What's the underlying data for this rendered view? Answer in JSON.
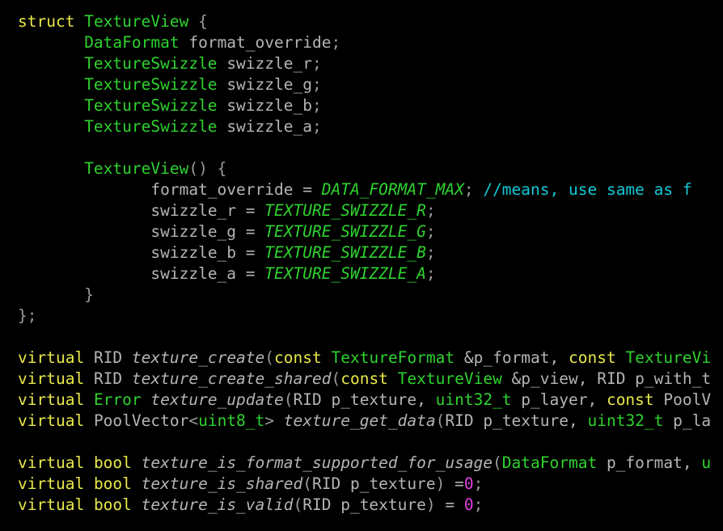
{
  "editor": {
    "language": "cpp",
    "background_color": "#000000",
    "default_text_color": "#b4b4b4",
    "font_size_px": 19.5,
    "line_height_px": 26,
    "tab_width_chars": 7,
    "lines_visible": 25,
    "horizontal_clipping": true
  },
  "theme": {
    "keyword": "#e8e84a",
    "type": "#2fd22f",
    "identifier": "#b4b4b4",
    "function_name": "#b4b4b4",
    "constant": "#2fd22f",
    "comment": "#14c8d7",
    "number": "#e040e0",
    "punctuation": "#9a9a9a"
  },
  "code": {
    "lines": [
      {
        "id": "line-1",
        "indent": 0,
        "tokens": [
          {
            "t": "struct",
            "k": "keyword"
          },
          {
            "t": " ",
            "k": "plain"
          },
          {
            "t": "TextureView",
            "k": "type"
          },
          {
            "t": " ",
            "k": "plain"
          },
          {
            "t": "{",
            "k": "punct"
          }
        ]
      },
      {
        "id": "line-2",
        "indent": 1,
        "tokens": [
          {
            "t": "DataFormat",
            "k": "type"
          },
          {
            "t": " ",
            "k": "plain"
          },
          {
            "t": "format_override",
            "k": "member"
          },
          {
            "t": ";",
            "k": "punct"
          }
        ]
      },
      {
        "id": "line-3",
        "indent": 1,
        "tokens": [
          {
            "t": "TextureSwizzle",
            "k": "type"
          },
          {
            "t": " ",
            "k": "plain"
          },
          {
            "t": "swizzle_r",
            "k": "member"
          },
          {
            "t": ";",
            "k": "punct"
          }
        ]
      },
      {
        "id": "line-4",
        "indent": 1,
        "tokens": [
          {
            "t": "TextureSwizzle",
            "k": "type"
          },
          {
            "t": " ",
            "k": "plain"
          },
          {
            "t": "swizzle_g",
            "k": "member"
          },
          {
            "t": ";",
            "k": "punct"
          }
        ]
      },
      {
        "id": "line-5",
        "indent": 1,
        "tokens": [
          {
            "t": "TextureSwizzle",
            "k": "type"
          },
          {
            "t": " ",
            "k": "plain"
          },
          {
            "t": "swizzle_b",
            "k": "member"
          },
          {
            "t": ";",
            "k": "punct"
          }
        ]
      },
      {
        "id": "line-6",
        "indent": 1,
        "tokens": [
          {
            "t": "TextureSwizzle",
            "k": "type"
          },
          {
            "t": " ",
            "k": "plain"
          },
          {
            "t": "swizzle_a",
            "k": "member"
          },
          {
            "t": ";",
            "k": "punct"
          }
        ]
      },
      {
        "id": "line-7",
        "indent": 0,
        "tokens": []
      },
      {
        "id": "line-8",
        "indent": 1,
        "tokens": [
          {
            "t": "TextureView",
            "k": "type"
          },
          {
            "t": "()",
            "k": "punct"
          },
          {
            "t": " ",
            "k": "plain"
          },
          {
            "t": "{",
            "k": "punct"
          }
        ]
      },
      {
        "id": "line-9",
        "indent": 2,
        "tokens": [
          {
            "t": "format_override",
            "k": "ident"
          },
          {
            "t": " = ",
            "k": "op"
          },
          {
            "t": "DATA_FORMAT_MAX",
            "k": "const"
          },
          {
            "t": ";",
            "k": "punct"
          },
          {
            "t": " ",
            "k": "plain"
          },
          {
            "t": "//means, use same as f",
            "k": "comment"
          }
        ]
      },
      {
        "id": "line-10",
        "indent": 2,
        "tokens": [
          {
            "t": "swizzle_r",
            "k": "ident"
          },
          {
            "t": " = ",
            "k": "op"
          },
          {
            "t": "TEXTURE_SWIZZLE_R",
            "k": "const"
          },
          {
            "t": ";",
            "k": "punct"
          }
        ]
      },
      {
        "id": "line-11",
        "indent": 2,
        "tokens": [
          {
            "t": "swizzle_g",
            "k": "ident"
          },
          {
            "t": " = ",
            "k": "op"
          },
          {
            "t": "TEXTURE_SWIZZLE_G",
            "k": "const"
          },
          {
            "t": ";",
            "k": "punct"
          }
        ]
      },
      {
        "id": "line-12",
        "indent": 2,
        "tokens": [
          {
            "t": "swizzle_b",
            "k": "ident"
          },
          {
            "t": " = ",
            "k": "op"
          },
          {
            "t": "TEXTURE_SWIZZLE_B",
            "k": "const"
          },
          {
            "t": ";",
            "k": "punct"
          }
        ]
      },
      {
        "id": "line-13",
        "indent": 2,
        "tokens": [
          {
            "t": "swizzle_a",
            "k": "ident"
          },
          {
            "t": " = ",
            "k": "op"
          },
          {
            "t": "TEXTURE_SWIZZLE_A",
            "k": "const"
          },
          {
            "t": ";",
            "k": "punct"
          }
        ]
      },
      {
        "id": "line-14",
        "indent": 1,
        "tokens": [
          {
            "t": "}",
            "k": "punct"
          }
        ]
      },
      {
        "id": "line-15",
        "indent": 0,
        "tokens": [
          {
            "t": "};",
            "k": "punct"
          }
        ]
      },
      {
        "id": "line-16",
        "indent": 0,
        "tokens": []
      },
      {
        "id": "line-17",
        "indent": 0,
        "tokens": [
          {
            "t": "virtual",
            "k": "keyword"
          },
          {
            "t": " ",
            "k": "plain"
          },
          {
            "t": "RID",
            "k": "ident"
          },
          {
            "t": " ",
            "k": "plain"
          },
          {
            "t": "texture_create",
            "k": "func"
          },
          {
            "t": "(",
            "k": "punct"
          },
          {
            "t": "const",
            "k": "keyword"
          },
          {
            "t": " ",
            "k": "plain"
          },
          {
            "t": "TextureFormat",
            "k": "type"
          },
          {
            "t": " &p_format, ",
            "k": "ident"
          },
          {
            "t": "const",
            "k": "keyword"
          },
          {
            "t": " ",
            "k": "plain"
          },
          {
            "t": "TextureVi",
            "k": "type"
          }
        ]
      },
      {
        "id": "line-18",
        "indent": 0,
        "tokens": [
          {
            "t": "virtual",
            "k": "keyword"
          },
          {
            "t": " ",
            "k": "plain"
          },
          {
            "t": "RID",
            "k": "ident"
          },
          {
            "t": " ",
            "k": "plain"
          },
          {
            "t": "texture_create_shared",
            "k": "func"
          },
          {
            "t": "(",
            "k": "punct"
          },
          {
            "t": "const",
            "k": "keyword"
          },
          {
            "t": " ",
            "k": "plain"
          },
          {
            "t": "TextureView",
            "k": "type"
          },
          {
            "t": " &p_view, RID p_with_t",
            "k": "ident"
          }
        ]
      },
      {
        "id": "line-19",
        "indent": 0,
        "tokens": [
          {
            "t": "virtual",
            "k": "keyword"
          },
          {
            "t": " ",
            "k": "plain"
          },
          {
            "t": "Error",
            "k": "type"
          },
          {
            "t": " ",
            "k": "plain"
          },
          {
            "t": "texture_update",
            "k": "func"
          },
          {
            "t": "(",
            "k": "punct"
          },
          {
            "t": "RID p_texture, ",
            "k": "ident"
          },
          {
            "t": "uint32_t",
            "k": "type"
          },
          {
            "t": " p_layer, ",
            "k": "ident"
          },
          {
            "t": "const",
            "k": "keyword"
          },
          {
            "t": " ",
            "k": "plain"
          },
          {
            "t": "PoolV",
            "k": "ident"
          }
        ]
      },
      {
        "id": "line-20",
        "indent": 0,
        "tokens": [
          {
            "t": "virtual",
            "k": "keyword"
          },
          {
            "t": " ",
            "k": "plain"
          },
          {
            "t": "PoolVector",
            "k": "ident"
          },
          {
            "t": "<",
            "k": "punct"
          },
          {
            "t": "uint8_t",
            "k": "type"
          },
          {
            "t": ">",
            "k": "punct"
          },
          {
            "t": " ",
            "k": "plain"
          },
          {
            "t": "texture_get_data",
            "k": "func"
          },
          {
            "t": "(",
            "k": "punct"
          },
          {
            "t": "RID p_texture, ",
            "k": "ident"
          },
          {
            "t": "uint32_t",
            "k": "type"
          },
          {
            "t": " p_la",
            "k": "ident"
          }
        ]
      },
      {
        "id": "line-21",
        "indent": 0,
        "tokens": []
      },
      {
        "id": "line-22",
        "indent": 0,
        "tokens": [
          {
            "t": "virtual",
            "k": "keyword"
          },
          {
            "t": " ",
            "k": "plain"
          },
          {
            "t": "bool",
            "k": "keyword"
          },
          {
            "t": " ",
            "k": "plain"
          },
          {
            "t": "texture_is_format_supported_for_usage",
            "k": "func"
          },
          {
            "t": "(",
            "k": "punct"
          },
          {
            "t": "DataFormat",
            "k": "type"
          },
          {
            "t": " p_format, ",
            "k": "ident"
          },
          {
            "t": "u",
            "k": "type"
          }
        ]
      },
      {
        "id": "line-23",
        "indent": 0,
        "tokens": [
          {
            "t": "virtual",
            "k": "keyword"
          },
          {
            "t": " ",
            "k": "plain"
          },
          {
            "t": "bool",
            "k": "keyword"
          },
          {
            "t": " ",
            "k": "plain"
          },
          {
            "t": "texture_is_shared",
            "k": "func"
          },
          {
            "t": "(",
            "k": "punct"
          },
          {
            "t": "RID p_texture",
            "k": "ident"
          },
          {
            "t": ")",
            "k": "punct"
          },
          {
            "t": " =",
            "k": "op"
          },
          {
            "t": "0",
            "k": "number"
          },
          {
            "t": ";",
            "k": "punct"
          }
        ]
      },
      {
        "id": "line-24",
        "indent": 0,
        "tokens": [
          {
            "t": "virtual",
            "k": "keyword"
          },
          {
            "t": " ",
            "k": "plain"
          },
          {
            "t": "bool",
            "k": "keyword"
          },
          {
            "t": " ",
            "k": "plain"
          },
          {
            "t": "texture_is_valid",
            "k": "func"
          },
          {
            "t": "(",
            "k": "punct"
          },
          {
            "t": "RID p_texture",
            "k": "ident"
          },
          {
            "t": ")",
            "k": "punct"
          },
          {
            "t": " = ",
            "k": "op"
          },
          {
            "t": "0",
            "k": "number"
          },
          {
            "t": ";",
            "k": "punct"
          }
        ]
      }
    ]
  }
}
